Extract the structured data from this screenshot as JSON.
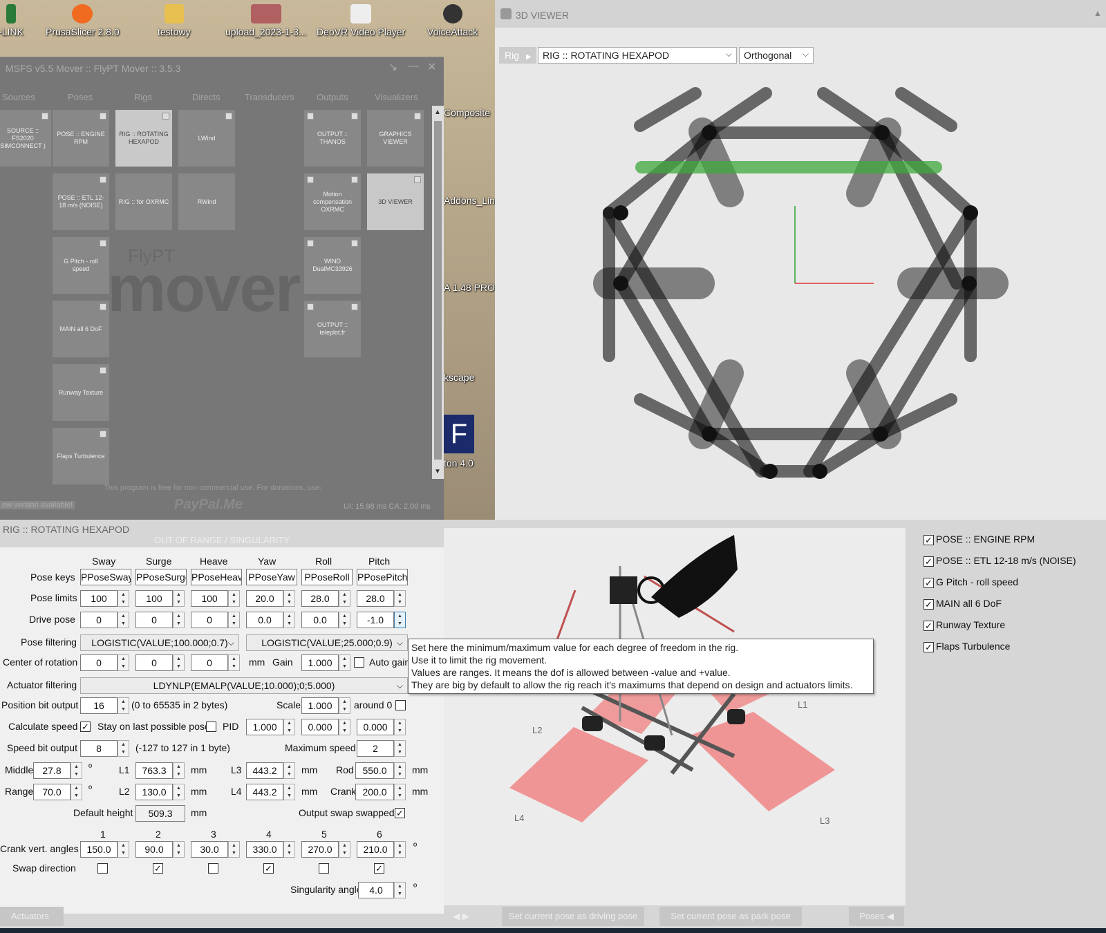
{
  "desktop": {
    "icons": [
      {
        "label": "-LINK"
      },
      {
        "label": "PrusaSlicer 2.8.0"
      },
      {
        "label": "testowy"
      },
      {
        "label": "upload_2023-1-3..."
      },
      {
        "label": "DeoVR Video Player"
      },
      {
        "label": "VoiceAttack"
      }
    ],
    "side_labels": [
      "Composite",
      "Addons_Lin...",
      "A 1.48 PRO",
      "kscape",
      "ton 4.0"
    ]
  },
  "mover": {
    "title": "MSFS v5.5 Mover :: FlyPT Mover :: 3.5.3",
    "tabs": [
      "Sources",
      "Poses",
      "Rigs",
      "Directs",
      "Transducers",
      "Outputs",
      "Visualizers"
    ],
    "cards": {
      "sources": [
        "SOURCE :: FS2020 SIMCONNECT )"
      ],
      "poses": [
        "POSE :: ENGINE RPM",
        "POSE :: ETL 12-18 m/s (NOISE)",
        "G Pitch - roll speed",
        "MAIN all 6 DoF",
        "Runway Texture",
        "Flaps Turbulence"
      ],
      "rigs": [
        "RIG :: ROTATING HEXAPOD",
        "RIG :: for OXRMC"
      ],
      "directs": [
        "LWind",
        "RWind"
      ],
      "outputs": [
        "OUTPUT :: THANOS",
        "Motion compensation OXRMC",
        "WIND DualMC33926",
        "OUTPUT :: teleplot.fr"
      ],
      "visualizers": [
        "GRAPHICS VIEWER",
        "3D VIEWER"
      ]
    },
    "watermark_small": "FlyPT",
    "watermark": "mover",
    "footer_note": "This program is free for non commercial use. For donations, use:",
    "new_version": "ew version available!",
    "paypal": "PayPal.Me",
    "timing": "UI: 15.98 ms  CA: 2.00 ms"
  },
  "viewer": {
    "title": "3D VIEWER",
    "rig_label": "Rig",
    "rig_select": "RIG :: ROTATING HEXAPOD",
    "projection": "Orthogonal"
  },
  "rig_panel": {
    "title": "RIG :: ROTATING HEXAPOD",
    "warning": "OUT OF RANGE / SINGULARITY",
    "dof_headers": [
      "Sway",
      "Surge",
      "Heave",
      "Yaw",
      "Roll",
      "Pitch"
    ],
    "pose_keys_label": "Pose keys",
    "pose_keys": [
      "PPoseSway",
      "PPoseSurge",
      "PPoseHeave",
      "PPoseYaw",
      "PPoseRoll",
      "PPosePitch"
    ],
    "pose_limits_label": "Pose limits",
    "pose_limits": [
      "100",
      "100",
      "100",
      "20.0",
      "28.0",
      "28.0"
    ],
    "drive_pose_label": "Drive pose",
    "drive_pose": [
      "0",
      "0",
      "0",
      "0.0",
      "0.0",
      "-1.0"
    ],
    "pose_filtering_label": "Pose filtering",
    "pose_filter_a": "LOGISTIC(VALUE;100.000;0.7)",
    "pose_filter_b": "LOGISTIC(VALUE;25.000;0.9)",
    "center_label": "Center of rotation",
    "center": [
      "0",
      "0",
      "0"
    ],
    "mm": "mm",
    "gain_label": "Gain",
    "gain": "1.000",
    "auto_gain": "Auto gain",
    "actuator_filtering_label": "Actuator filtering",
    "actuator_filter": "LDYNLP(EMALP(VALUE;10.000);0;5.000)",
    "pos_bit_label": "Position bit output",
    "pos_bit": "16",
    "pos_bit_note": "(0 to 65535 in 2 bytes)",
    "scale_label": "Scale",
    "scale": "1.000",
    "around0": "around 0",
    "calc_speed_label": "Calculate speed",
    "stay_label": "Stay on last possible pose",
    "pid_label": "PID",
    "pid": [
      "1.000",
      "0.000",
      "0.000"
    ],
    "speed_bit_label": "Speed bit output",
    "speed_bit": "8",
    "speed_bit_note": "(-127 to 127 in 1 byte)",
    "max_speed_label": "Maximum speed",
    "max_speed": "2",
    "middle_label": "Middle",
    "middle": "27.8",
    "range_label": "Range",
    "range": "70.0",
    "deg": "º",
    "L1_label": "L1",
    "L1": "763.3",
    "L2_label": "L2",
    "L2": "130.0",
    "L3_label": "L3",
    "L3": "443.2",
    "L4_label": "L4",
    "L4": "443.2",
    "rod_label": "Rod",
    "rod": "550.0",
    "crank_label": "Crank",
    "crank": "200.0",
    "default_height_label": "Default height",
    "default_height": "509.3",
    "output_swap_label": "Output swap swapped",
    "actuator_nums": [
      "1",
      "2",
      "3",
      "4",
      "5",
      "6"
    ],
    "crank_angles_label": "Crank vert. angles",
    "crank_angles": [
      "150.0",
      "90.0",
      "30.0",
      "330.0",
      "270.0",
      "210.0"
    ],
    "swap_dir_label": "Swap direction",
    "swap_dir": [
      false,
      true,
      false,
      true,
      false,
      true
    ],
    "singularity_label": "Singularity angle",
    "singularity": "4.0",
    "actuators_tab": "Actuators",
    "set_driving": "Set current pose as driving pose",
    "set_park": "Set current pose as park pose",
    "poses_tab": "Poses"
  },
  "tooltip": {
    "lines": [
      "Set here the minimum/maximum value for each degree of freedom in the rig.",
      "Use it to limit the rig movement.",
      "Values are ranges. It means the dof is allowed between -value and +value.",
      "They are big by default to allow the rig reach it's maximums that depend on design and actuators limits."
    ]
  },
  "render_labels": [
    "L1",
    "L2",
    "L3",
    "L4"
  ],
  "pose_list": [
    {
      "label": "POSE :: ENGINE RPM",
      "checked": true
    },
    {
      "label": "POSE :: ETL 12-18 m/s (NOISE)",
      "checked": true
    },
    {
      "label": "G Pitch - roll speed",
      "checked": true
    },
    {
      "label": "MAIN all 6 DoF",
      "checked": true
    },
    {
      "label": "Runway Texture",
      "checked": true
    },
    {
      "label": "Flaps Turbulence",
      "checked": true
    }
  ],
  "colors": {
    "green_highlight": "#3da83d",
    "red_planes": "#f08080",
    "axis_red": "#e03030",
    "axis_green": "#30a030"
  }
}
